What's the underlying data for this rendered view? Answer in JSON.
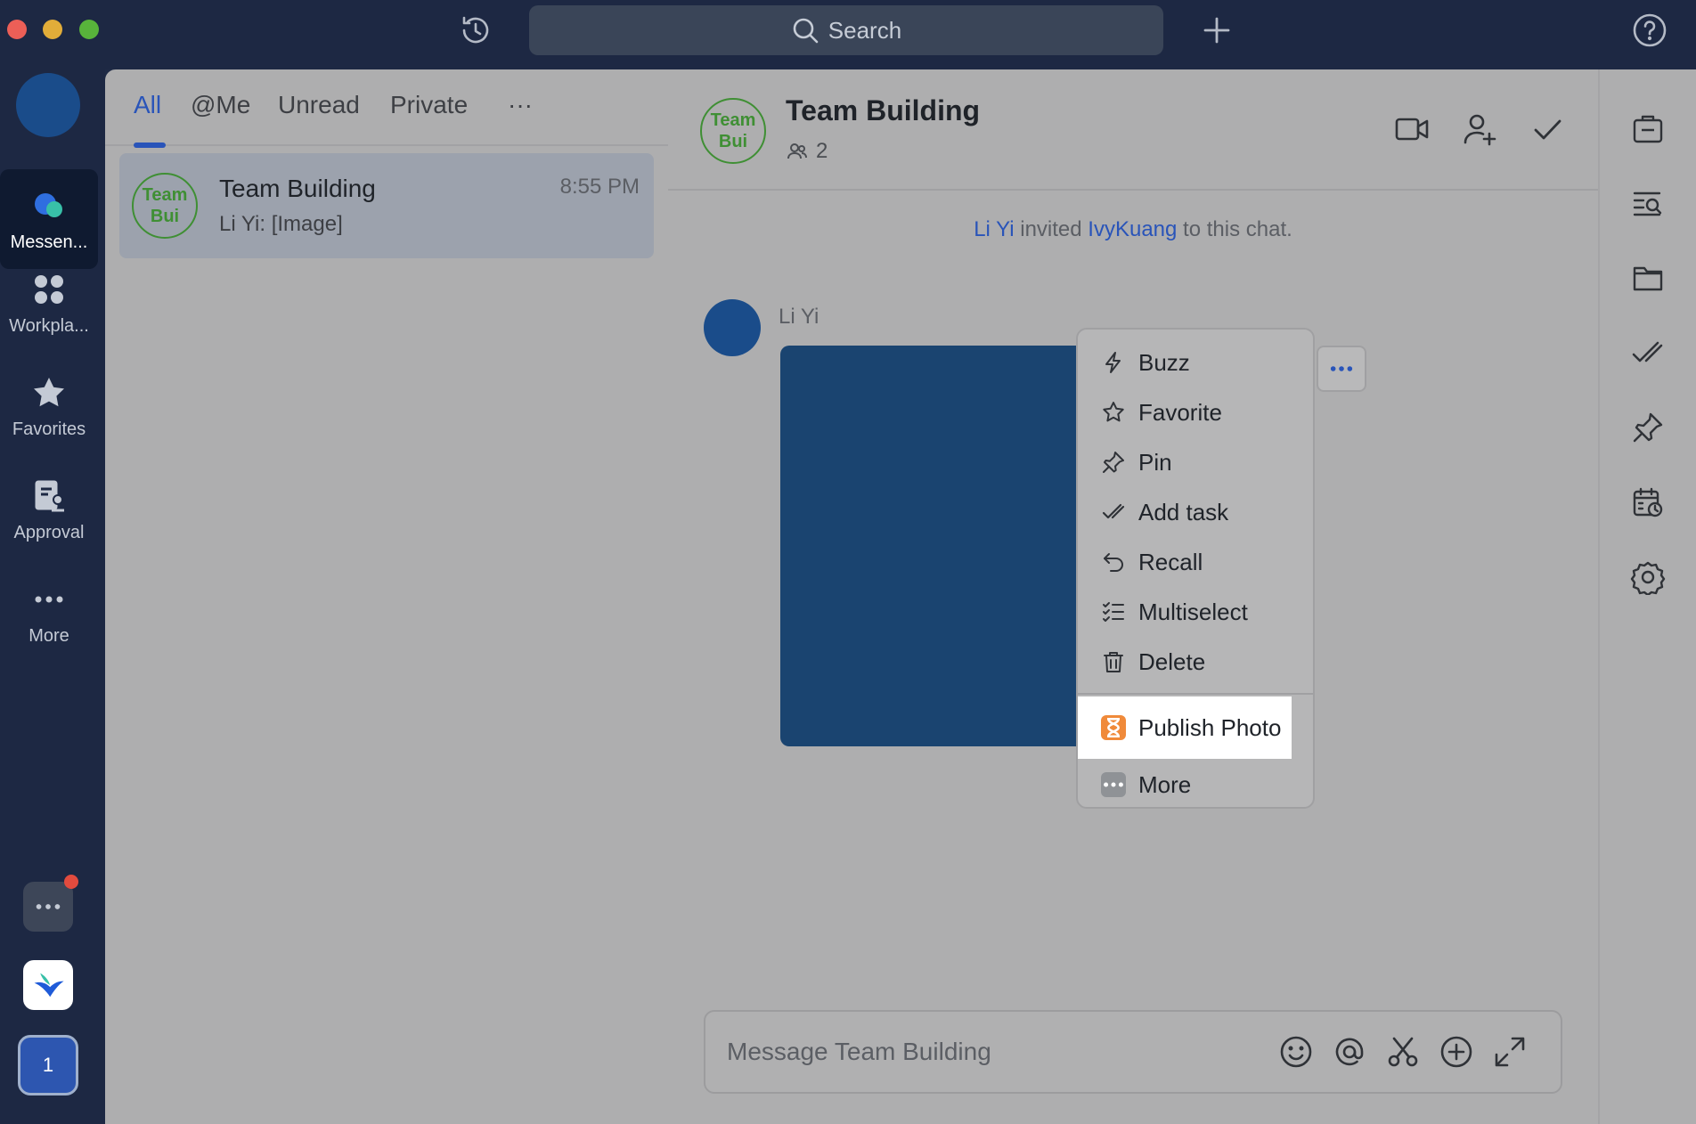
{
  "topbar": {
    "search_label": "Search"
  },
  "rail": {
    "items": [
      {
        "label": "Messen..."
      },
      {
        "label": "Workpla..."
      },
      {
        "label": "Favorites"
      },
      {
        "label": "Approval"
      },
      {
        "label": "More"
      }
    ],
    "app_badge_number": "1"
  },
  "list": {
    "tabs": [
      {
        "label": "All"
      },
      {
        "label": "@Me"
      },
      {
        "label": "Unread"
      },
      {
        "label": "Private"
      },
      {
        "label": "···"
      }
    ],
    "chats": [
      {
        "avatar_line1": "Team",
        "avatar_line2": "Bui",
        "name": "Team Building",
        "preview": "Li Yi: [Image]",
        "time": "8:55 PM"
      }
    ]
  },
  "chat": {
    "avatar_line1": "Team",
    "avatar_line2": "Bui",
    "title": "Team Building",
    "member_count": "2",
    "system_message": {
      "actor": "Li Yi",
      "verb": "invited",
      "target": "IvyKuang",
      "suffix": "to this chat."
    },
    "sender_name": "Li Yi",
    "composer_placeholder": "Message Team Building"
  },
  "context_menu": {
    "items": [
      {
        "label": "Buzz",
        "icon": "bolt-icon"
      },
      {
        "label": "Favorite",
        "icon": "star-icon"
      },
      {
        "label": "Pin",
        "icon": "pin-icon"
      },
      {
        "label": "Add task",
        "icon": "check-icon"
      },
      {
        "label": "Recall",
        "icon": "undo-icon"
      },
      {
        "label": "Multiselect",
        "icon": "checklist-icon"
      },
      {
        "label": "Delete",
        "icon": "trash-icon"
      }
    ],
    "app_items": [
      {
        "label": "Publish Photo",
        "icon": "hourglass-app-icon",
        "color": "#f08a3a"
      },
      {
        "label": "More",
        "icon": "dots-app-icon",
        "color": "#8f9296"
      }
    ]
  },
  "colors": {
    "accent": "#2954b9",
    "team_green": "#3f8f34",
    "image_blue": "#1a4470"
  }
}
